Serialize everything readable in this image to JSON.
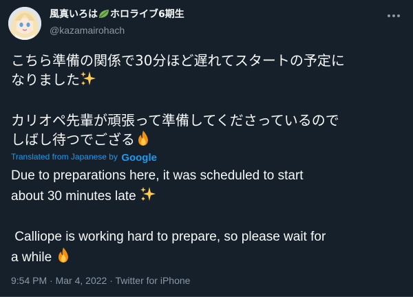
{
  "tweet": {
    "display_name": "風真いろは",
    "display_name_suffix": "ホロライブ6期生",
    "handle": "@kazamairohach",
    "text_ja_line1": "こちら準備の関係で30分ほど遅れてスタートの予定に",
    "text_ja_line2": "なりました",
    "text_ja_line3": "カリオペ先輩が頑張って準備してくださっているので",
    "text_ja_line4": "しばし待つでござる",
    "translated_label": "Translated from Japanese by",
    "translator": "Google",
    "text_en_line1": "Due to preparations here, it was scheduled to start",
    "text_en_line2": "about 30 minutes late",
    "text_en_line3": " Calliope is working hard to prepare, so please wait for",
    "text_en_line4": "a while",
    "time": "9:54 PM",
    "date": "Mar 4, 2022",
    "source": "Twitter for iPhone"
  },
  "icons": {
    "avatar": "avatar",
    "leaf": "leaf-icon",
    "more": "more-icon",
    "sparkles": "sparkles-icon",
    "fire": "fire-icon"
  },
  "colors": {
    "background": "#15202b",
    "text": "#f7f9f9",
    "secondary": "#8b98a5",
    "link": "#1d9bf0"
  }
}
